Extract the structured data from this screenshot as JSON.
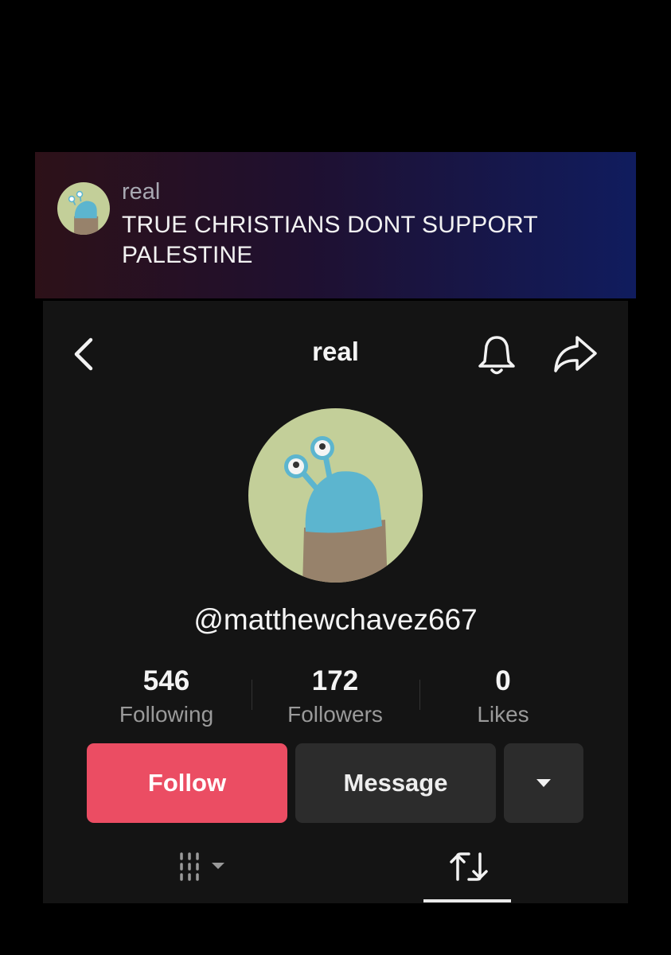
{
  "comment": {
    "username": "real",
    "text": "TRUE CHRISTIANS DONT SUPPORT PALESTINE"
  },
  "profile": {
    "title": "real",
    "handle": "@matthewchavez667",
    "stats": {
      "following": {
        "value": "546",
        "label": "Following"
      },
      "followers": {
        "value": "172",
        "label": "Followers"
      },
      "likes": {
        "value": "0",
        "label": "Likes"
      }
    },
    "buttons": {
      "follow": "Follow",
      "message": "Message"
    }
  },
  "icons": {
    "back": "chevron-left-icon",
    "notifications": "bell-icon",
    "share": "share-arrow-icon",
    "more": "caret-down-icon",
    "videos_tab": "grid-lines-icon",
    "reposts_tab": "repost-icon"
  },
  "colors": {
    "follow_button": "#eb4d63",
    "panel_background": "#141414",
    "secondary_button": "#2c2c2c",
    "avatar_background": "#c3cf99"
  }
}
